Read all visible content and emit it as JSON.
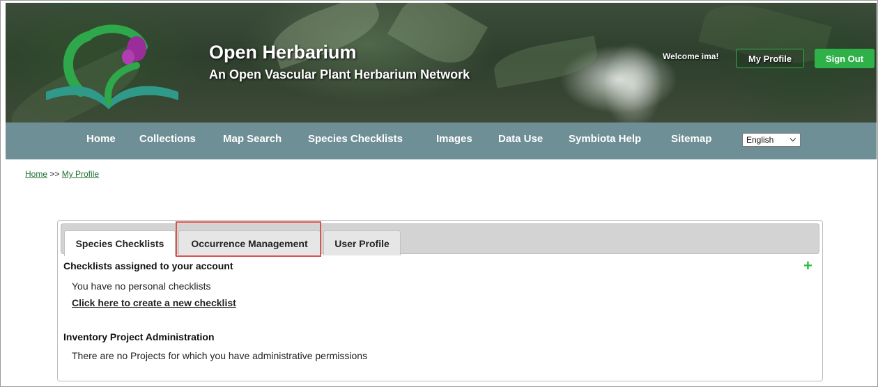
{
  "header": {
    "title": "Open Herbarium",
    "subtitle": "An Open Vascular Plant Herbarium Network",
    "welcome": "Welcome ima!",
    "my_profile_label": "My Profile",
    "sign_out_label": "Sign Out"
  },
  "nav": {
    "items": [
      "Home",
      "Collections",
      "Map Search",
      "Species Checklists",
      "Images",
      "Data Use",
      "Symbiota Help",
      "Sitemap"
    ],
    "language": "English"
  },
  "breadcrumb": {
    "home": "Home",
    "separator": ">>",
    "current": "My Profile"
  },
  "tabs": [
    {
      "label": "Species Checklists",
      "active": true
    },
    {
      "label": "Occurrence Management",
      "active": false
    },
    {
      "label": "User Profile",
      "active": false
    }
  ],
  "checklists": {
    "title": "Checklists assigned to your account",
    "empty_text": "You have no personal checklists",
    "create_link": "Click here to create a new checklist"
  },
  "projects": {
    "title": "Inventory Project Administration",
    "empty_text": "There are no Projects for which you have administrative permissions"
  },
  "colors": {
    "nav_bg": "#6f8f97",
    "accent_green": "#2fb14a",
    "highlight": "#d9534f"
  }
}
